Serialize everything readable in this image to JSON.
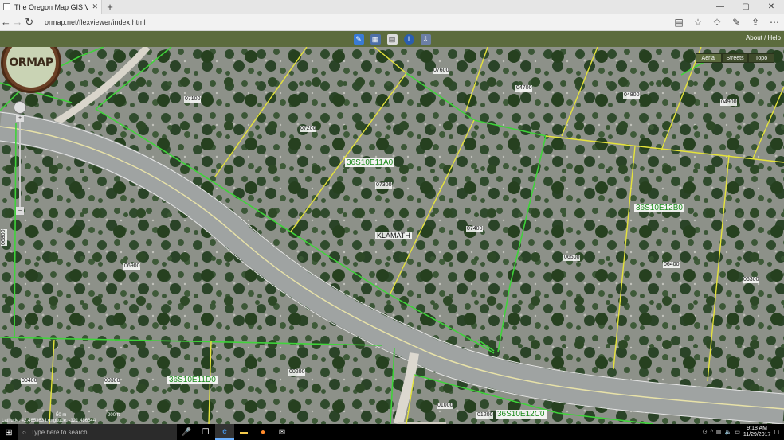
{
  "browser": {
    "tab_title": "The Oregon Map GIS Vi",
    "tab_close": "✕",
    "new_tab": "+",
    "url": "ormap.net/flexviewer/index.html",
    "back": "←",
    "forward": "→",
    "refresh": "↻",
    "win_min": "—",
    "win_max": "▢",
    "win_close": "✕"
  },
  "app": {
    "about_help": "About / Help",
    "logo": "ORMAP"
  },
  "basemap": {
    "buttons": [
      "Aerial",
      "Streets",
      "Topo"
    ],
    "active": "Aerial"
  },
  "map": {
    "township_labels": [
      "36S10E11A0",
      "36S10E12B0",
      "36S10E11D0",
      "36S10E12C0"
    ],
    "county": "KLAMATH",
    "parcels": [
      "07600",
      "07100",
      "04700",
      "04800",
      "04900",
      "07200",
      "07300",
      "07400",
      "06500",
      "06400",
      "06300",
      "06900",
      "06800",
      "00400",
      "00300",
      "00200",
      "01000",
      "01200"
    ],
    "coords": "Latitude: 42.465363 Longitude: -121.486644",
    "scale_label": "50 m",
    "scale_label2": "200 ft"
  },
  "taskbar": {
    "search_placeholder": "Type here to search",
    "time": "9:18 AM",
    "date": "11/29/2017"
  },
  "colors": {
    "header": "#5c6b3d",
    "taxlot_line": "#e5e33b",
    "township_line": "#3fd33a"
  }
}
